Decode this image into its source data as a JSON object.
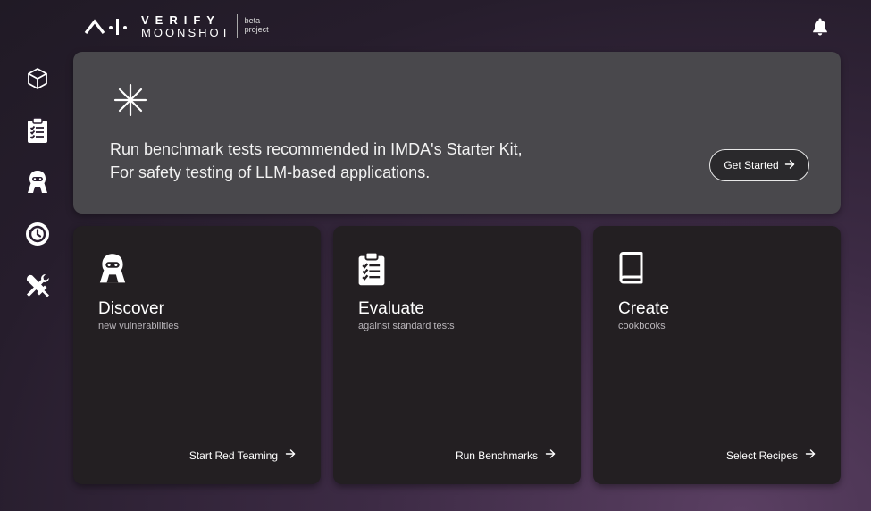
{
  "header": {
    "logo_line1": "VERIFY",
    "logo_line2": "MOONSHOT",
    "beta_line1": "beta",
    "beta_line2": "project",
    "bell_icon": "bell-icon"
  },
  "sidebar": {
    "items": [
      {
        "icon": "cube-icon"
      },
      {
        "icon": "clipboard-list-icon"
      },
      {
        "icon": "red-teaming-agent-icon"
      },
      {
        "icon": "history-icon"
      },
      {
        "icon": "tools-icon"
      }
    ]
  },
  "banner": {
    "icon": "sparkle-asterisk-icon",
    "line1": "Run benchmark tests recommended in IMDA's Starter Kit,",
    "line2": "For safety testing of LLM-based applications.",
    "button_label": "Get Started"
  },
  "cards": [
    {
      "icon": "red-teaming-agent-icon",
      "title": "Discover",
      "subtitle": "new vulnerabilities",
      "link": "Start Red Teaming"
    },
    {
      "icon": "clipboard-list-icon",
      "title": "Evaluate",
      "subtitle": "against standard tests",
      "link": "Run Benchmarks"
    },
    {
      "icon": "book-icon",
      "title": "Create",
      "subtitle": "cookbooks",
      "link": "Select Recipes"
    }
  ],
  "colors": {
    "banner_bg": "#49484c",
    "card_bg": "#231f22",
    "page_bg": "#2a1f30"
  }
}
